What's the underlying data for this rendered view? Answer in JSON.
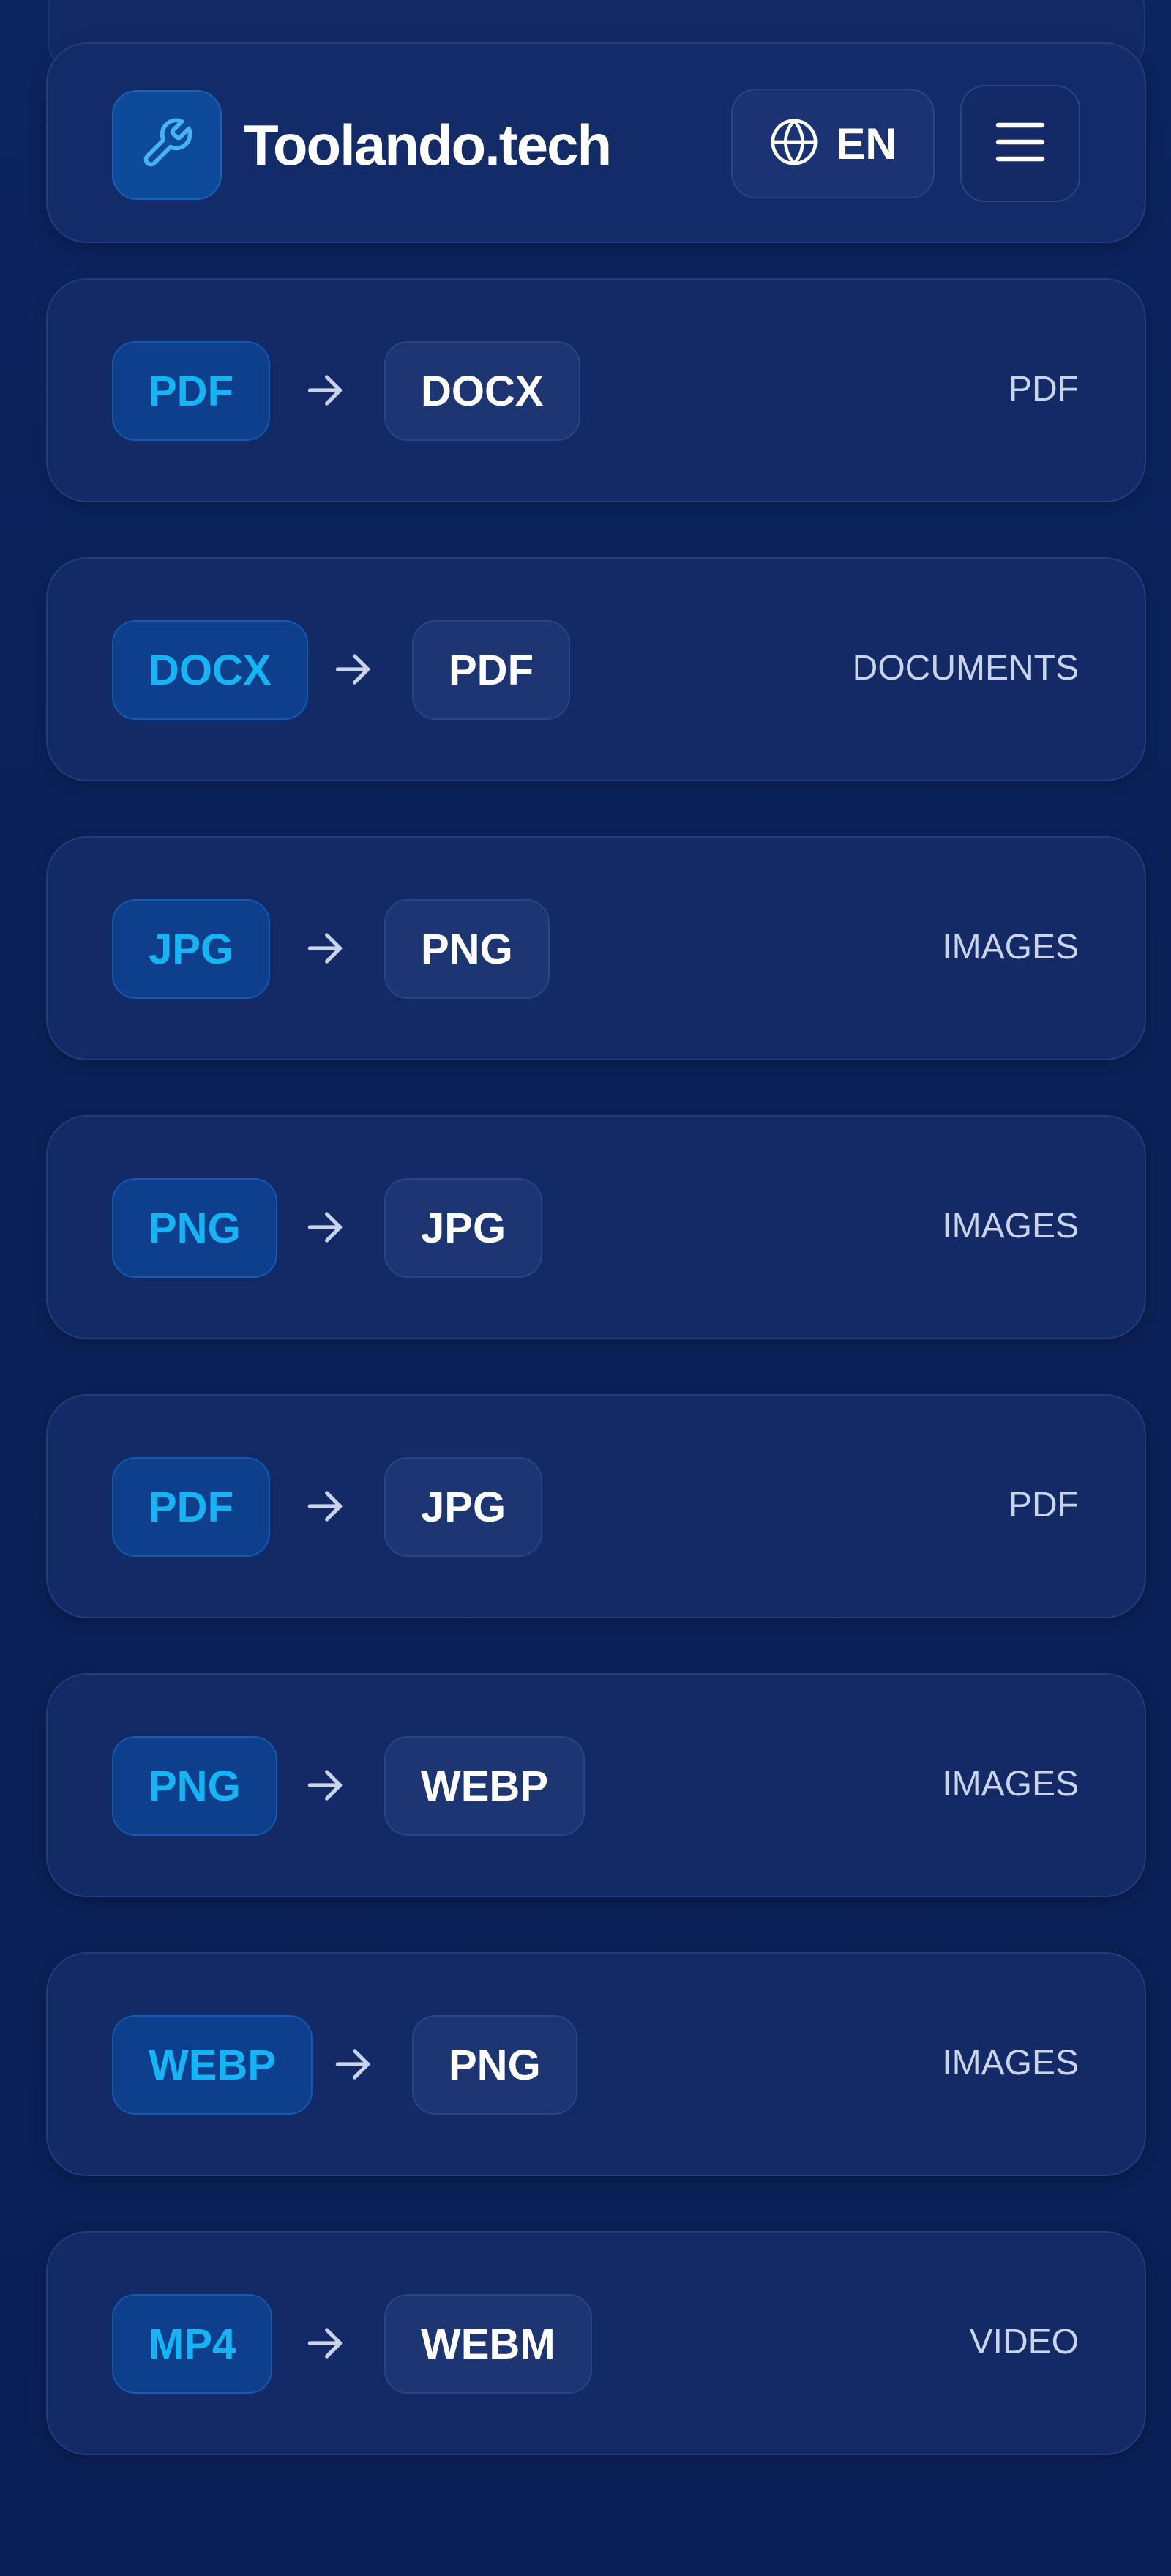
{
  "header": {
    "brand": "Toolando.tech",
    "logo_icon": "wrench-icon",
    "language_label": "EN",
    "language_icon": "globe-icon",
    "menu_icon": "hamburger-menu-icon"
  },
  "conversions": [
    {
      "from": "PDF",
      "to": "DOCX",
      "category": "PDF"
    },
    {
      "from": "DOCX",
      "to": "PDF",
      "category": "DOCUMENTS"
    },
    {
      "from": "JPG",
      "to": "PNG",
      "category": "IMAGES"
    },
    {
      "from": "PNG",
      "to": "JPG",
      "category": "IMAGES"
    },
    {
      "from": "PDF",
      "to": "JPG",
      "category": "PDF"
    },
    {
      "from": "PNG",
      "to": "WEBP",
      "category": "IMAGES"
    },
    {
      "from": "WEBP",
      "to": "PNG",
      "category": "IMAGES"
    },
    {
      "from": "MP4",
      "to": "WEBM",
      "category": "VIDEO"
    }
  ],
  "colors": {
    "background": "#0b2157",
    "card": "#142a66",
    "accent": "#14b4f5",
    "from_pill": "#0d3f8c",
    "to_pill": "#1d3572",
    "category_text": "#c9d3ea"
  }
}
